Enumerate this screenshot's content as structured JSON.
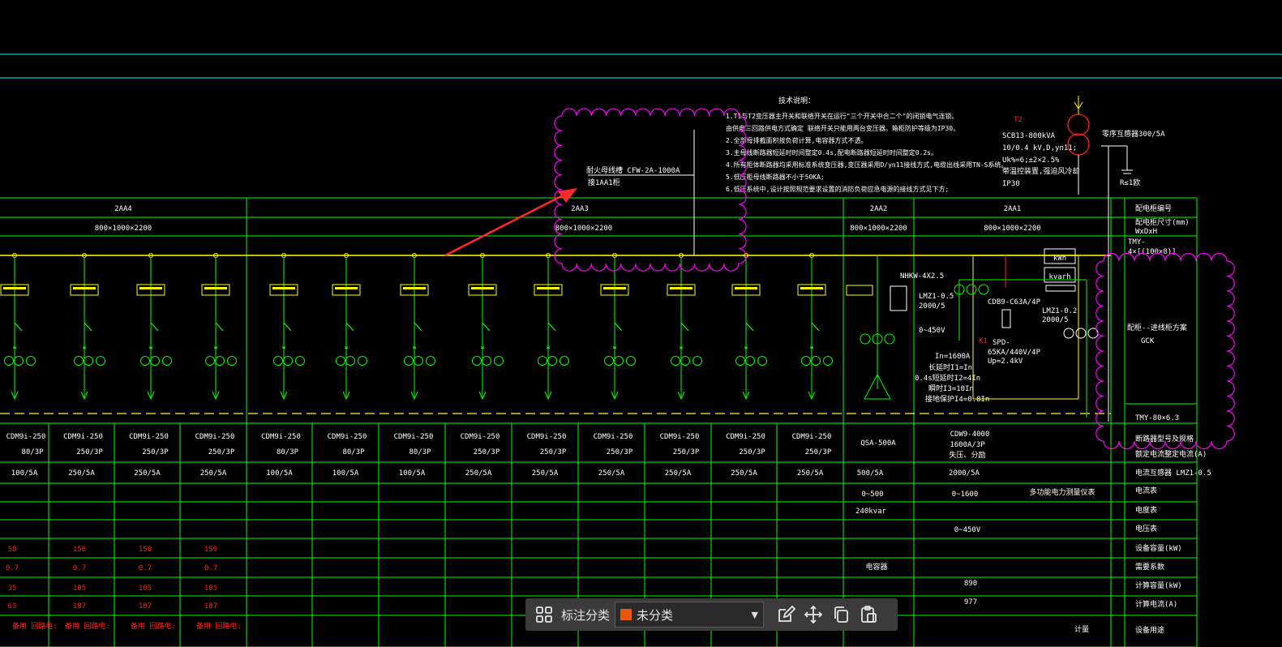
{
  "drawing": {
    "notes": {
      "title": "技术说明：",
      "lines": [
        "1.T1与T2变压器主开关和联络开关在运行\"三个开关中合二个\"的闭锁电气连锁。",
        "   由供电三回路供电方式确定 联络开关只能用两台变压器。箱柜防护等级为IP30。",
        "2.全部母排截面积按负荷计算,电容器方式不透。",
        "3.主母线断路器短延时时间整定0.4s,配电断路器短延时时间整定0.2s。",
        "4.所有柜体断路器均采用标准系统变压器,变压器采用D/yn11接线方式,电缆出线采用TN-S系统。",
        "5.低压柜母线断路器不小于50KA;",
        "6.低压系统中,设计按照规范要求设置的消防负荷应急电源的接线方式见下方;"
      ]
    },
    "callout": {
      "line1": "耐火母线槽  CFW-2A-1000A",
      "line2": "接1AA1柜"
    },
    "transformer": {
      "tag": "T2",
      "model": "SCB13-800kVA",
      "ratio": "10/0.4 kV,D,yn11;",
      "uk": "Uk%=6;±2×2.5%",
      "note": "带温控装置,强迫风冷却",
      "ip": "IP30",
      "right_label": "零序互感器300/5A",
      "ground": "R≤1欧"
    },
    "header_row_label": "配电柜编号",
    "size_row_label": "配电柜尺寸(mm)",
    "size_row_sub": "WxDxH",
    "busbar_label": "TMY-",
    "busbar_label2": "4×[(100×8)]",
    "cabinet_type_label": "配柜--进线柜方案",
    "cabinet_type": "GCK",
    "bottom_busbar": "TMY-80×6.3",
    "panels": [
      {
        "id": "2AA4",
        "size": "800×1000×2200"
      },
      {
        "id": "2AA3",
        "size": "800×1000×2200"
      },
      {
        "id": "2AA2",
        "size": "800×1000×2200"
      },
      {
        "id": "2AA1",
        "size": "800×1000×2200"
      }
    ],
    "feeder_breakers": [
      {
        "model": "CDM9i-250",
        "rating": "80/3P",
        "ct": "100/5A"
      },
      {
        "model": "CDM9i-250",
        "rating": "250/3P",
        "ct": "250/5A"
      },
      {
        "model": "CDM9i-250",
        "rating": "250/3P",
        "ct": "250/5A"
      },
      {
        "model": "CDM9i-250",
        "rating": "250/3P",
        "ct": "250/5A"
      },
      {
        "model": "CDM9i-250",
        "rating": "80/3P",
        "ct": "100/5A"
      },
      {
        "model": "CDM9i-250",
        "rating": "80/3P",
        "ct": "100/5A"
      },
      {
        "model": "CDM9i-250",
        "rating": "80/3P",
        "ct": "100/5A"
      },
      {
        "model": "CDM9i-250",
        "rating": "250/3P",
        "ct": "250/5A"
      },
      {
        "model": "CDM9i-250",
        "rating": "250/3P",
        "ct": "250/5A"
      },
      {
        "model": "CDM9i-250",
        "rating": "250/3P",
        "ct": "250/5A"
      },
      {
        "model": "CDM9i-250",
        "rating": "250/3P",
        "ct": "250/5A"
      },
      {
        "model": "CDM9i-250",
        "rating": "250/3P",
        "ct": "250/5A"
      },
      {
        "model": "CDM9i-250",
        "rating": "250/3P",
        "ct": "250/5A"
      }
    ],
    "capacitor": {
      "breaker": "QSA-500A",
      "ct": "500/5A",
      "range": "0~500",
      "kvar": "240kvar",
      "label": "电容器"
    },
    "incoming": {
      "breaker": "CDW9-4000",
      "rating": "1600A/3P",
      "note": "失压、分励",
      "ct": "2000/5A",
      "ammeter": "0~1600",
      "meter_note": "多功能电力测量仪表",
      "volt": "0~450V",
      "power": "890",
      "current": "977",
      "bottom": "计量"
    },
    "cap_detail": {
      "nhkw": "NHKW-4X2.5",
      "lmz": "LMZ1-0.5",
      "lmz_ratio": "2000/5",
      "volt": "0~450V",
      "in": "In=1600A",
      "ir1": "长延时I1=In",
      "ir2": "0.4s短延时I2=4In",
      "ir3": "瞬时I3=10In",
      "ir4": "接地保护I4=0.8In",
      "spd": "CDB9-C63A/4P",
      "spd2": "SPD-",
      "spd3": "65KA/440V/4P",
      "up": "Up≈2.4kV",
      "k": "K1",
      "lmz2": "LMZ1-0.2",
      "lmz2_ratio": "2000/5",
      "kwh": "kWh",
      "kvarh": "kvarh"
    },
    "right_rows": [
      "断路器型号及规格",
      "额定电流整定电流(A)",
      "电流互感器  LMZ1-0.5",
      "电流表",
      "电度表",
      "电压表",
      "设备容量(kW)",
      "需要系数",
      "计算容量(kW)",
      "计算电流(A)",
      "设备用途"
    ],
    "left_red_rows": {
      "p": [
        "50",
        "150",
        "150",
        "150"
      ],
      "k": [
        "0.7",
        "0.7",
        "0.7",
        "0.7"
      ],
      "pc": [
        "35",
        "105",
        "105",
        "105"
      ],
      "ic": [
        "63",
        "187",
        "187",
        "187"
      ],
      "use": [
        "备用 回路电:",
        "备用 回路电:",
        "备用 回路电:",
        "备用 回路电:"
      ]
    },
    "colors": {
      "line": "#00ff00",
      "bus": "#ffff00",
      "text": "#ffffff",
      "red": "#ff2020",
      "cloud": "#ff00ff",
      "cyan": "#00ffff",
      "arrow": "#ff2a2a"
    }
  },
  "toolbar": {
    "grid_icon": "grid-view-icon",
    "label": "标注分类",
    "select_value": "未分类",
    "select_color": "#e8570f",
    "tools": [
      "edit-icon",
      "move-icon",
      "copy-icon",
      "paste-icon"
    ]
  }
}
